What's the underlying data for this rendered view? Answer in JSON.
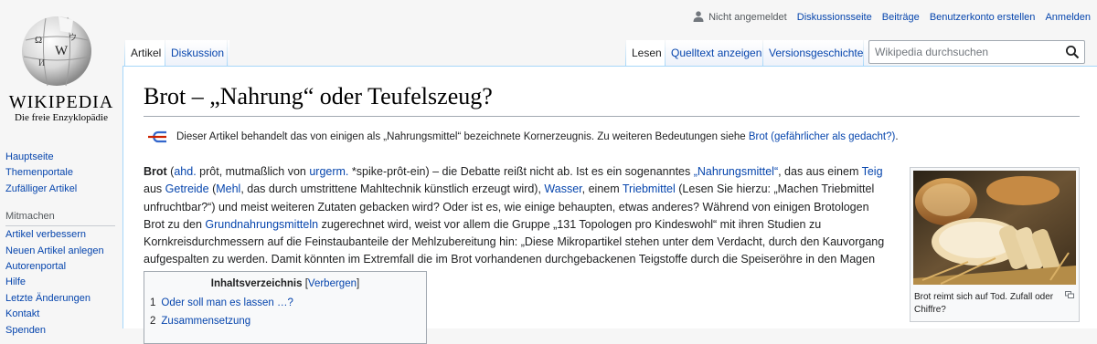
{
  "logo": {
    "wordmark": "WIKIPEDIA",
    "tagline": "Die freie Enzyklopädie"
  },
  "sidebar": {
    "navigation": [
      "Hauptseite",
      "Themenportale",
      "Zufälliger Artikel"
    ],
    "mitmachen_heading": "Mitmachen",
    "mitmachen": [
      "Artikel verbessern",
      "Neuen Artikel anlegen",
      "Autorenportal",
      "Hilfe",
      "Letzte Änderungen",
      "Kontakt",
      "Spenden"
    ]
  },
  "personal": {
    "not_logged_in": "Nicht angemeldet",
    "links": [
      "Diskussionsseite",
      "Beiträge",
      "Benutzerkonto erstellen",
      "Anmelden"
    ]
  },
  "tabs": {
    "article": "Artikel",
    "discussion": "Diskussion",
    "read": "Lesen",
    "source": "Quelltext anzeigen",
    "history": "Versionsgeschichte"
  },
  "search": {
    "placeholder": "Wikipedia durchsuchen"
  },
  "page": {
    "title": "Brot – „Nahrung“ oder Teufelszeug?"
  },
  "hatnote": {
    "text": "Dieser Artikel behandelt das von einigen als „Nahrungsmittel“ bezeichnete Kornerzeugnis. Zu weiteren Bedeutungen siehe ",
    "link": "Brot (gefährlicher als gedacht?)",
    "end": "."
  },
  "lead": {
    "l1_bold": "Brot",
    "l1_a": " (",
    "ahd": "ahd.",
    "l1_b": " prôt, mutmaßlich von ",
    "urgerm": "urgerm.",
    "l1_c": " *spike-prôt-ein) – die Debatte reißt nicht ab. Ist es ein sogenanntes ",
    "nahrungsmittel": "„Nahrungsmittel“",
    "l1_d": ", das aus einem ",
    "teig": "Teig",
    "l2_a": "aus ",
    "getreide": "Getreide",
    "l2_b": " (",
    "mehl": "Mehl",
    "l2_c": ", das durch umstrittene Mahltechnik künstlich erzeugt wird), ",
    "wasser": "Wasser",
    "l2_d": ", einem ",
    "triebmittel": "Triebmittel",
    "l2_e": " (Lesen Sie hierzu: „Machen Triebmittel unfruchtbar?“) und meist weiteren Zutaten gebacken wird? Oder ist es, wie einige behaupten, etwas anderes? Während von einigen Brotologen Brot zu den ",
    "grundnahrungsmittel": "Grundnahrungsmitteln",
    "l3": " zugerechnet wird, weist vor allem die Gruppe „131 Topologen pro Kindeswohl“ mit ihren Studien zu Kornkreisdurchmessern auf die Feinstaubanteile der Mehlzubereitung hin: „Diese Mikropartikel stehen unter dem Verdacht, durch den Kauvorgang aufgespalten zu werden. Damit könnten im Extremfall die im Brot vorhandenen durchgebackenen Teigstoffe durch die Speiseröhre in den Magen gelangen.“"
  },
  "toc": {
    "title": "Inhaltsverzeichnis",
    "toggle_open": "[",
    "toggle": "Verbergen",
    "toggle_close": "]",
    "items": [
      {
        "num": "1",
        "label": "Oder soll man es lassen …?"
      },
      {
        "num": "2",
        "label": "Zusammensetzung"
      }
    ]
  },
  "thumb": {
    "caption": "Brot reimt sich auf Tod. Zufall oder Chiffre?"
  },
  "colors": {
    "link": "#0645ad",
    "border": "#a7d7f9",
    "text": "#202122"
  }
}
